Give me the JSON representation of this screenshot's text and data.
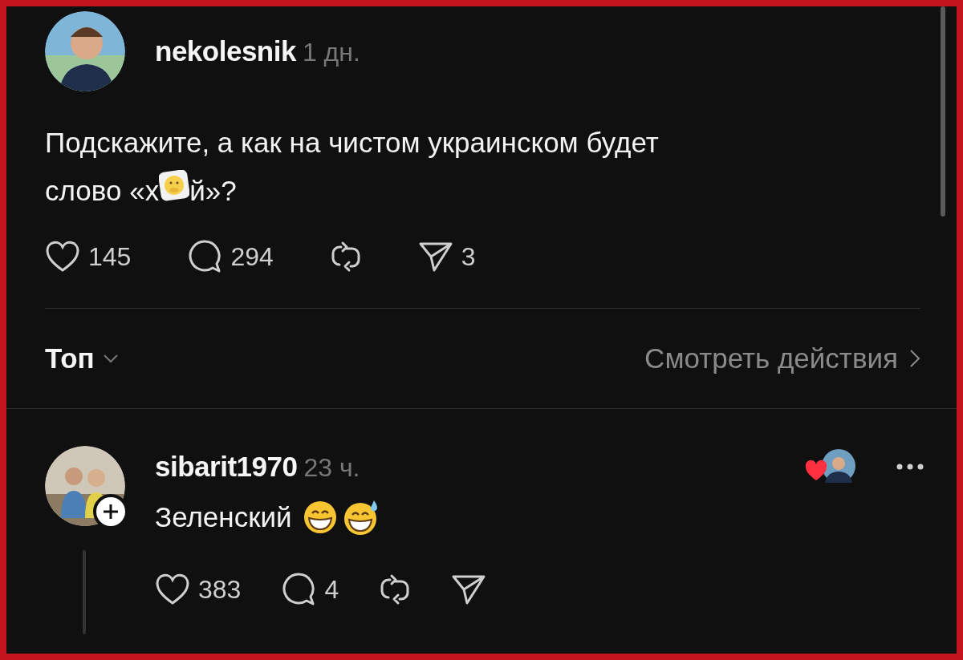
{
  "post": {
    "author": "nekolesnik",
    "time": "1 дн.",
    "text_line_1": "Подскажите, а как на чистом украинском будет",
    "text_line_2": {
      "before_sticker": "слово «х",
      "after_sticker": "й»?"
    },
    "actions": [
      {
        "kind": "like",
        "count": "145"
      },
      {
        "kind": "reply",
        "count": "294"
      },
      {
        "kind": "repost"
      },
      {
        "kind": "share",
        "count": "3"
      }
    ]
  },
  "sort": {
    "label": "Топ",
    "link": "Смотреть действия"
  },
  "replies": [
    {
      "author": "sibarit1970",
      "time": "23 ч.",
      "text": "Зеленский",
      "liked_by_author": true,
      "actions": [
        {
          "kind": "like",
          "count": "383"
        },
        {
          "kind": "reply",
          "count": "4"
        },
        {
          "kind": "repost"
        },
        {
          "kind": "share"
        }
      ]
    }
  ]
}
